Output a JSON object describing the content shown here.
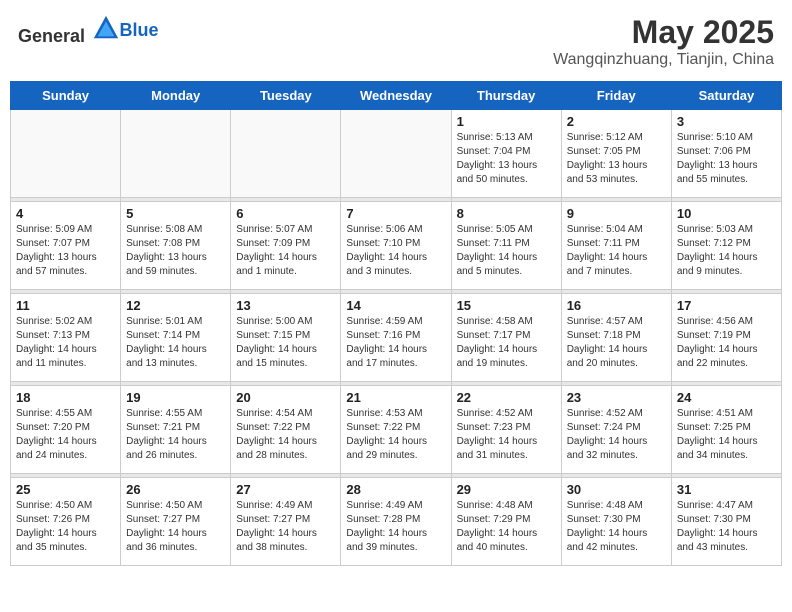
{
  "header": {
    "logo_general": "General",
    "logo_blue": "Blue",
    "month": "May 2025",
    "location": "Wangqinzhuang, Tianjin, China"
  },
  "weekdays": [
    "Sunday",
    "Monday",
    "Tuesday",
    "Wednesday",
    "Thursday",
    "Friday",
    "Saturday"
  ],
  "weeks": [
    [
      {
        "day": "",
        "info": ""
      },
      {
        "day": "",
        "info": ""
      },
      {
        "day": "",
        "info": ""
      },
      {
        "day": "",
        "info": ""
      },
      {
        "day": "1",
        "info": "Sunrise: 5:13 AM\nSunset: 7:04 PM\nDaylight: 13 hours\nand 50 minutes."
      },
      {
        "day": "2",
        "info": "Sunrise: 5:12 AM\nSunset: 7:05 PM\nDaylight: 13 hours\nand 53 minutes."
      },
      {
        "day": "3",
        "info": "Sunrise: 5:10 AM\nSunset: 7:06 PM\nDaylight: 13 hours\nand 55 minutes."
      }
    ],
    [
      {
        "day": "4",
        "info": "Sunrise: 5:09 AM\nSunset: 7:07 PM\nDaylight: 13 hours\nand 57 minutes."
      },
      {
        "day": "5",
        "info": "Sunrise: 5:08 AM\nSunset: 7:08 PM\nDaylight: 13 hours\nand 59 minutes."
      },
      {
        "day": "6",
        "info": "Sunrise: 5:07 AM\nSunset: 7:09 PM\nDaylight: 14 hours\nand 1 minute."
      },
      {
        "day": "7",
        "info": "Sunrise: 5:06 AM\nSunset: 7:10 PM\nDaylight: 14 hours\nand 3 minutes."
      },
      {
        "day": "8",
        "info": "Sunrise: 5:05 AM\nSunset: 7:11 PM\nDaylight: 14 hours\nand 5 minutes."
      },
      {
        "day": "9",
        "info": "Sunrise: 5:04 AM\nSunset: 7:11 PM\nDaylight: 14 hours\nand 7 minutes."
      },
      {
        "day": "10",
        "info": "Sunrise: 5:03 AM\nSunset: 7:12 PM\nDaylight: 14 hours\nand 9 minutes."
      }
    ],
    [
      {
        "day": "11",
        "info": "Sunrise: 5:02 AM\nSunset: 7:13 PM\nDaylight: 14 hours\nand 11 minutes."
      },
      {
        "day": "12",
        "info": "Sunrise: 5:01 AM\nSunset: 7:14 PM\nDaylight: 14 hours\nand 13 minutes."
      },
      {
        "day": "13",
        "info": "Sunrise: 5:00 AM\nSunset: 7:15 PM\nDaylight: 14 hours\nand 15 minutes."
      },
      {
        "day": "14",
        "info": "Sunrise: 4:59 AM\nSunset: 7:16 PM\nDaylight: 14 hours\nand 17 minutes."
      },
      {
        "day": "15",
        "info": "Sunrise: 4:58 AM\nSunset: 7:17 PM\nDaylight: 14 hours\nand 19 minutes."
      },
      {
        "day": "16",
        "info": "Sunrise: 4:57 AM\nSunset: 7:18 PM\nDaylight: 14 hours\nand 20 minutes."
      },
      {
        "day": "17",
        "info": "Sunrise: 4:56 AM\nSunset: 7:19 PM\nDaylight: 14 hours\nand 22 minutes."
      }
    ],
    [
      {
        "day": "18",
        "info": "Sunrise: 4:55 AM\nSunset: 7:20 PM\nDaylight: 14 hours\nand 24 minutes."
      },
      {
        "day": "19",
        "info": "Sunrise: 4:55 AM\nSunset: 7:21 PM\nDaylight: 14 hours\nand 26 minutes."
      },
      {
        "day": "20",
        "info": "Sunrise: 4:54 AM\nSunset: 7:22 PM\nDaylight: 14 hours\nand 28 minutes."
      },
      {
        "day": "21",
        "info": "Sunrise: 4:53 AM\nSunset: 7:22 PM\nDaylight: 14 hours\nand 29 minutes."
      },
      {
        "day": "22",
        "info": "Sunrise: 4:52 AM\nSunset: 7:23 PM\nDaylight: 14 hours\nand 31 minutes."
      },
      {
        "day": "23",
        "info": "Sunrise: 4:52 AM\nSunset: 7:24 PM\nDaylight: 14 hours\nand 32 minutes."
      },
      {
        "day": "24",
        "info": "Sunrise: 4:51 AM\nSunset: 7:25 PM\nDaylight: 14 hours\nand 34 minutes."
      }
    ],
    [
      {
        "day": "25",
        "info": "Sunrise: 4:50 AM\nSunset: 7:26 PM\nDaylight: 14 hours\nand 35 minutes."
      },
      {
        "day": "26",
        "info": "Sunrise: 4:50 AM\nSunset: 7:27 PM\nDaylight: 14 hours\nand 36 minutes."
      },
      {
        "day": "27",
        "info": "Sunrise: 4:49 AM\nSunset: 7:27 PM\nDaylight: 14 hours\nand 38 minutes."
      },
      {
        "day": "28",
        "info": "Sunrise: 4:49 AM\nSunset: 7:28 PM\nDaylight: 14 hours\nand 39 minutes."
      },
      {
        "day": "29",
        "info": "Sunrise: 4:48 AM\nSunset: 7:29 PM\nDaylight: 14 hours\nand 40 minutes."
      },
      {
        "day": "30",
        "info": "Sunrise: 4:48 AM\nSunset: 7:30 PM\nDaylight: 14 hours\nand 42 minutes."
      },
      {
        "day": "31",
        "info": "Sunrise: 4:47 AM\nSunset: 7:30 PM\nDaylight: 14 hours\nand 43 minutes."
      }
    ]
  ]
}
